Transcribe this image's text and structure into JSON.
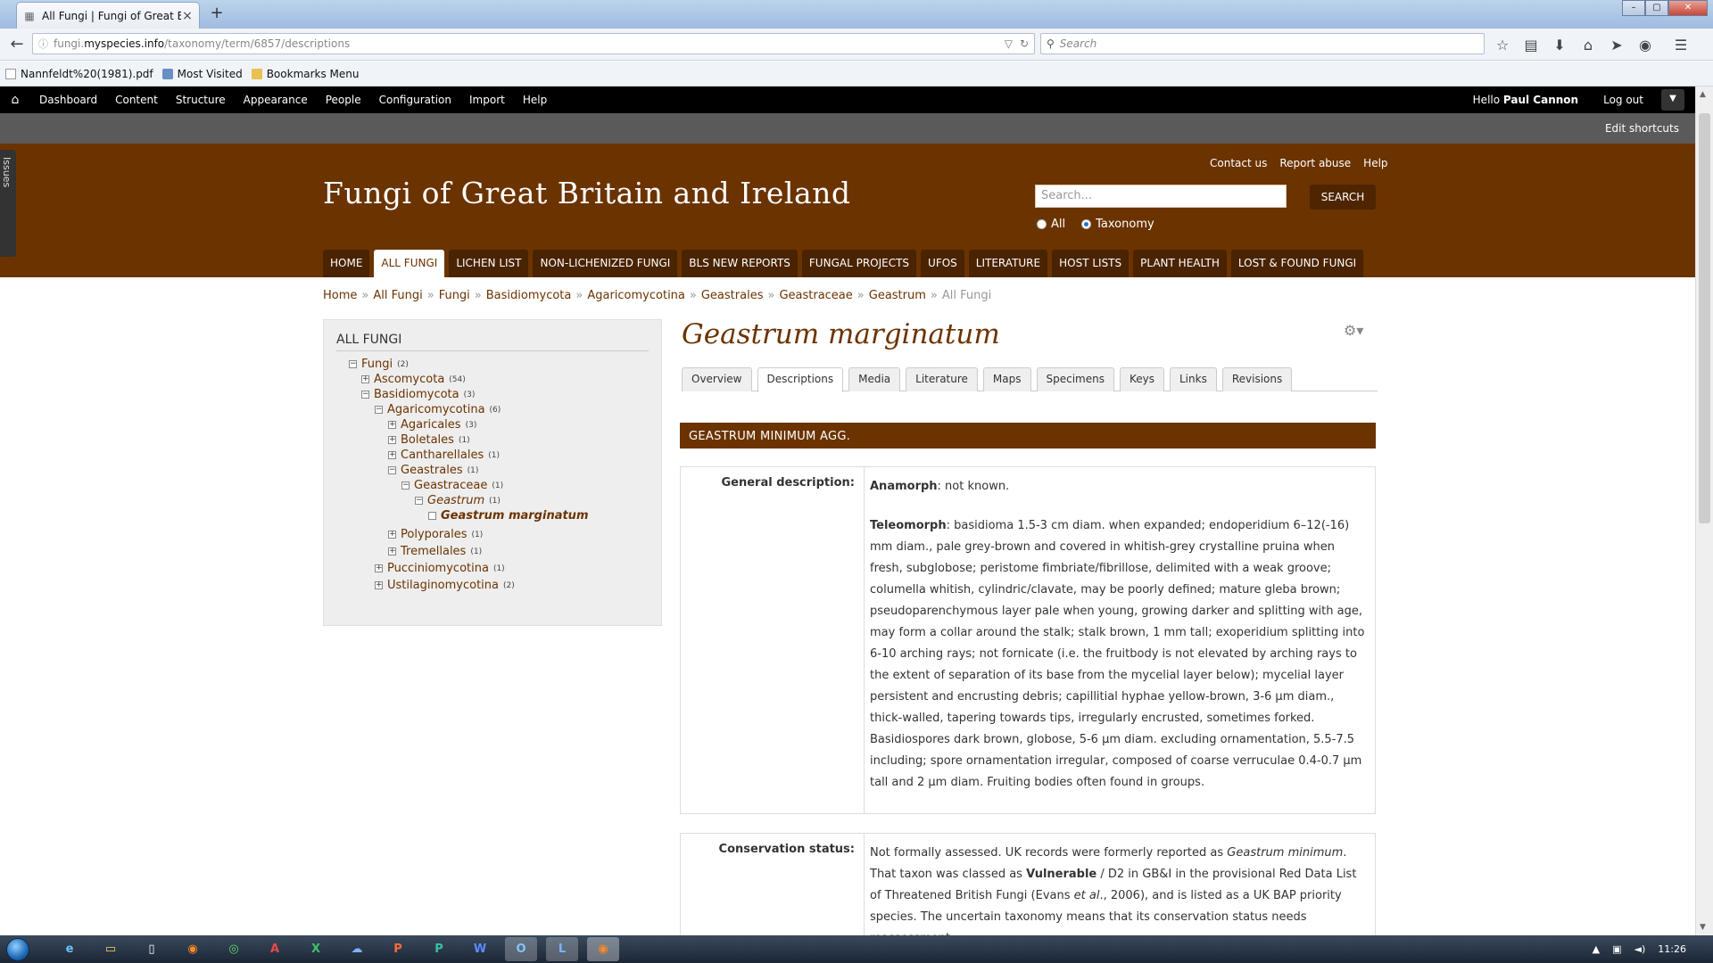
{
  "browser": {
    "tab_title": "All Fungi | Fungi of Great B...",
    "url_prefix": "fungi.",
    "url_domain": "myspecies.info",
    "url_path": "/taxonomy/term/6857/descriptions",
    "search_placeholder": "Search",
    "bookmarks": [
      "Nannfeldt%20(1981).pdf",
      "Most Visited",
      "Bookmarks Menu"
    ]
  },
  "admin": {
    "items": [
      "Dashboard",
      "Content",
      "Structure",
      "Appearance",
      "People",
      "Configuration",
      "Import",
      "Help"
    ],
    "hello": "Hello",
    "user": "Paul Cannon",
    "logout": "Log out",
    "edit_shortcuts": "Edit shortcuts",
    "issues_tab": "Issues"
  },
  "site": {
    "title": "Fungi of Great Britain and Ireland",
    "top_links": [
      "Contact us",
      "Report abuse",
      "Help"
    ],
    "search_placeholder": "Search...",
    "search_button": "SEARCH",
    "radio_all": "All",
    "radio_taxonomy": "Taxonomy",
    "menu": [
      "HOME",
      "ALL FUNGI",
      "LICHEN LIST",
      "NON-LICHENIZED FUNGI",
      "BLS NEW REPORTS",
      "FUNGAL PROJECTS",
      "UFOS",
      "LITERATURE",
      "HOST LISTS",
      "PLANT HEALTH",
      "LOST & FOUND FUNGI"
    ],
    "active_menu": "ALL FUNGI"
  },
  "breadcrumb": {
    "links": [
      "Home",
      "All Fungi",
      "Fungi",
      "Basidiomycota",
      "Agaricomycotina",
      "Geastrales",
      "Geastraceae",
      "Geastrum"
    ],
    "sep": "»",
    "current": "All Fungi"
  },
  "sidebar": {
    "heading": "ALL FUNGI",
    "tree": [
      {
        "label": "Fungi",
        "count": "(2)"
      },
      {
        "label": "Ascomycota",
        "count": "(54)"
      },
      {
        "label": "Basidiomycota",
        "count": "(3)"
      },
      {
        "label": "Agaricomycotina",
        "count": "(6)"
      },
      {
        "label": "Agaricales",
        "count": "(3)"
      },
      {
        "label": "Boletales",
        "count": "(1)"
      },
      {
        "label": "Cantharellales",
        "count": "(1)"
      },
      {
        "label": "Geastrales",
        "count": "(1)"
      },
      {
        "label": "Geastraceae",
        "count": "(1)"
      },
      {
        "label": "Geastrum",
        "count": "(1)"
      },
      {
        "label": "Geastrum marginatum",
        "count": ""
      },
      {
        "label": "Polyporales",
        "count": "(1)"
      },
      {
        "label": "Tremellales",
        "count": "(1)"
      },
      {
        "label": "Pucciniomycotina",
        "count": "(1)"
      },
      {
        "label": "Ustilaginomycotina",
        "count": "(2)"
      }
    ]
  },
  "main": {
    "title": "Geastrum marginatum",
    "tabs": [
      "Overview",
      "Descriptions",
      "Media",
      "Literature",
      "Maps",
      "Specimens",
      "Keys",
      "Links",
      "Revisions"
    ],
    "active_tab": "Descriptions",
    "section_title": "GEASTRUM MINIMUM AGG.",
    "general_label": "General description:",
    "anamorph_label": "Anamorph",
    "anamorph_text": ": not known.",
    "teleomorph_label": "Teleomorph",
    "teleomorph_text": ": basidioma 1.5-3 cm diam. when expanded; endoperidium 6–12(-16) mm diam., pale grey-brown and covered in whitish-grey crystalline pruina when fresh, subglobose; peristome fimbriate/fibrillose, delimited with a weak groove; columella whitish, cylindric/clavate, may be poorly defined; mature gleba brown; pseudoparenchymous layer pale when young, growing darker and splitting with age, may form a collar around the stalk; stalk brown, 1 mm tall; exoperidium splitting into 6-10 arching rays;  not fornicate (i.e. the fruitbody is not elevated by arching rays to the extent of separation of its base from the mycelial layer below); mycelial layer persistent and encrusting debris; capillitial hyphae yellow-brown, 3-6 µm diam., thick-walled, tapering towards tips, irregularly encrusted, sometimes forked. Basidiospores dark brown, globose, 5-6 µm diam. excluding ornamentation, 5.5-7.5 including; spore ornamentation irregular, composed of coarse verruculae 0.4-0.7 µm tall and 2 µm  diam. Fruiting bodies often found in groups.",
    "conservation_label": "Conservation status:",
    "cons_1": "Not formally assessed. UK records were formerly reported as ",
    "cons_species": "Geastrum minimum",
    "cons_2": ". That taxon was classed as ",
    "cons_vuln": "Vulnerable",
    "cons_3": " / D2 in GB&I in the provisional Red Data List of Threatened British Fungi (Evans ",
    "cons_etal": "et al",
    "cons_4": "., 2006), and is listed as a UK BAP priority species. The uncertain taxonomy means that its conservation status needs reassessment."
  },
  "taskbar": {
    "icons": [
      "internet-explorer",
      "explorer",
      "file",
      "firefox",
      "chrome",
      "acrobat",
      "excel",
      "onedrive",
      "powerpoint",
      "publisher",
      "word",
      "outlook",
      "lync",
      "firefox-active"
    ],
    "clock": "11:26"
  }
}
